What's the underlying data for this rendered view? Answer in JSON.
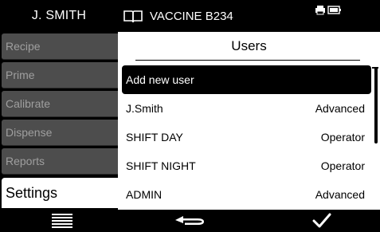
{
  "header": {
    "user": "J. SMITH",
    "product": "VACCINE B234",
    "book_icon": "book-icon",
    "status_icons": [
      "printer-icon",
      "battery-icon"
    ]
  },
  "sidebar": {
    "items": [
      {
        "label": "Recipe",
        "active": false
      },
      {
        "label": "Prime",
        "active": false
      },
      {
        "label": "Calibrate",
        "active": false
      },
      {
        "label": "Dispense",
        "active": false
      },
      {
        "label": "Reports",
        "active": false
      },
      {
        "label": "Settings",
        "active": true
      }
    ]
  },
  "main": {
    "title": "Users",
    "rows": [
      {
        "name": "Add new user",
        "role": ""
      },
      {
        "name": "J.Smith",
        "role": "Advanced"
      },
      {
        "name": "SHIFT DAY",
        "role": "Operator"
      },
      {
        "name": "SHIFT NIGHT",
        "role": "Operator"
      },
      {
        "name": "ADMIN",
        "role": "Advanced"
      }
    ]
  },
  "footer": {
    "buttons": [
      "menu-icon",
      "back-icon",
      "confirm-check-icon"
    ]
  },
  "colors": {
    "background": "#000000",
    "sidebar_inactive": "#4d4d4d",
    "sidebar_text_inactive": "#9f9f9f",
    "panel": "#ffffff"
  }
}
